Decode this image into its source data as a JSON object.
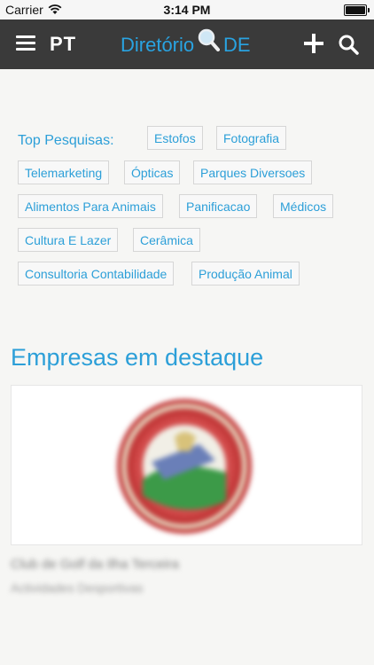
{
  "status_bar": {
    "carrier": "Carrier",
    "time": "3:14 PM"
  },
  "navbar": {
    "language": "PT",
    "logo_text_left": "Diretório",
    "logo_text_right": "DE",
    "icons": [
      "menu-icon",
      "plus-icon",
      "search-icon"
    ]
  },
  "top_searches": {
    "label": "Top Pesquisas:",
    "items": [
      "Estofos",
      "Fotografia",
      "Telemarketing",
      "Ópticas",
      "Parques Diversoes",
      "Alimentos Para Animais",
      "Panificacao",
      "Médicos",
      "Cultura E Lazer",
      "Cerâmica",
      "Consultoria Contabilidade",
      "Produção Animal"
    ]
  },
  "featured": {
    "title": "Empresas em destaque",
    "company": {
      "name": "Club de Golf da Ilha Terceira",
      "category": "Actividades Desportivas"
    }
  },
  "colors": {
    "accent": "#2c9fd8",
    "navbar": "#3a3a3a",
    "background": "#f6f6f4"
  }
}
